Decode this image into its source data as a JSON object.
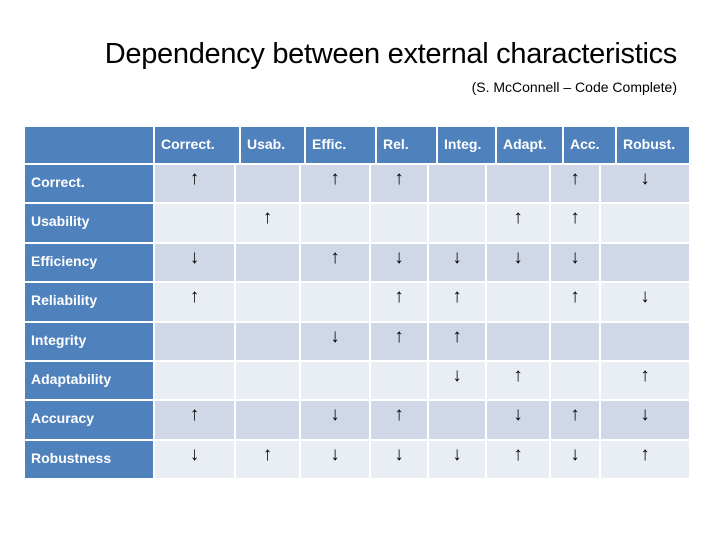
{
  "title": "Dependency between external characteristics",
  "subtitle": "(S. McConnell – Code Complete)",
  "colors": {
    "header_bg": "#4f81bd",
    "header_text": "#ffffff",
    "row_odd_bg": "#d0d8e8",
    "row_even_bg": "#e9edf4"
  },
  "symbols": {
    "up": "↑",
    "down": "↓",
    "none": ""
  },
  "table": {
    "corner": "",
    "columns": [
      "Correct.",
      "Usab.",
      "Effic.",
      "Rel.",
      "Integ.",
      "Adapt.",
      "Acc.",
      "Robust."
    ],
    "rows": [
      {
        "label": "Correct.",
        "cells": [
          "↑",
          "",
          "↑",
          "↑",
          "",
          "",
          "↑",
          "↓"
        ]
      },
      {
        "label": "Usability",
        "cells": [
          "",
          "↑",
          "",
          "",
          "",
          "↑",
          "↑",
          ""
        ]
      },
      {
        "label": "Efficiency",
        "cells": [
          "↓",
          "",
          "↑",
          "↓",
          "↓",
          "↓",
          "↓",
          ""
        ]
      },
      {
        "label": "Reliability",
        "cells": [
          "↑",
          "",
          "",
          "↑",
          "↑",
          "",
          "↑",
          "↓"
        ]
      },
      {
        "label": "Integrity",
        "cells": [
          "",
          "",
          "↓",
          "↑",
          "↑",
          "",
          "",
          ""
        ]
      },
      {
        "label": "Adaptability",
        "cells": [
          "",
          "",
          "",
          "",
          "↓",
          "↑",
          "",
          "↑"
        ]
      },
      {
        "label": "Accuracy",
        "cells": [
          "↑",
          "",
          "↓",
          "↑",
          "",
          "↓",
          "↑",
          "↓"
        ]
      },
      {
        "label": "Robustness",
        "cells": [
          "↓",
          "↑",
          "↓",
          "↓",
          "↓",
          "↑",
          "↓",
          "↑"
        ]
      }
    ]
  }
}
